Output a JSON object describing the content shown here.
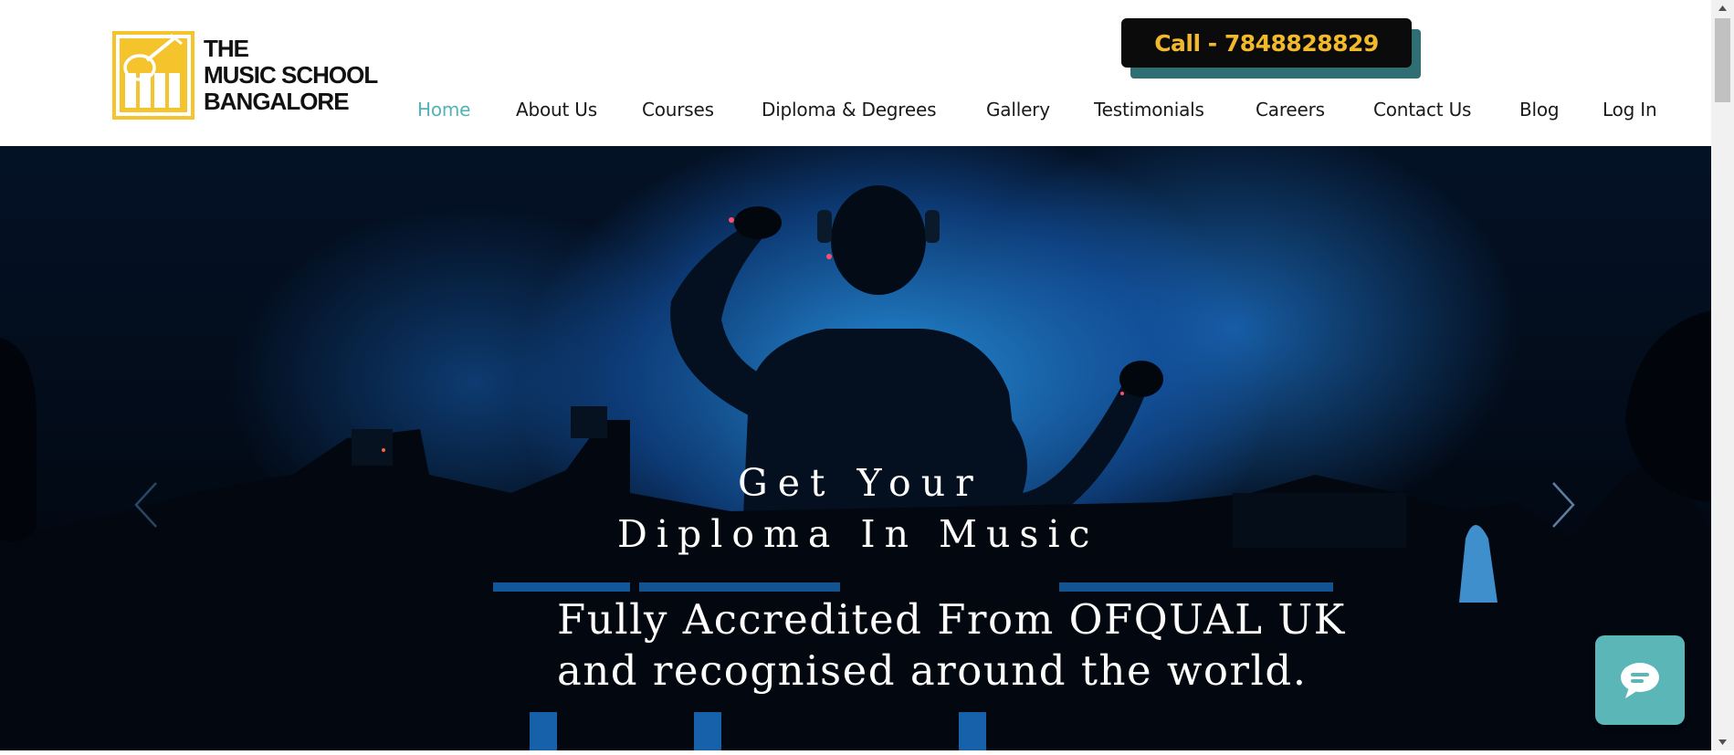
{
  "logo": {
    "line1": "THE",
    "line2": "MUSIC SCHOOL",
    "line3": "BANGALORE",
    "icon": "piano-guitar-logo-icon",
    "color": "#f5c32c"
  },
  "call_button": {
    "label": "Call - 7848828829",
    "text_color": "#f2b92b",
    "bg_color": "#0b0b0b",
    "shadow_color": "#2f6f73"
  },
  "nav": {
    "active_color": "#52b3b6",
    "items": [
      {
        "label": "Home",
        "active": true
      },
      {
        "label": "About Us"
      },
      {
        "label": "Courses"
      },
      {
        "label": "Diploma & Degrees"
      },
      {
        "label": "Gallery"
      },
      {
        "label": "Testimonials"
      },
      {
        "label": "Careers"
      },
      {
        "label": "Contact Us"
      },
      {
        "label": "Blog"
      },
      {
        "label": "Log In"
      }
    ]
  },
  "hero": {
    "line1": "Get Your",
    "line2": "Diploma In Music",
    "line3": "Fully Accredited From OFQUAL UK",
    "line4": "and recognised around the world.",
    "prev_icon": "chevron-left-icon",
    "next_icon": "chevron-right-icon"
  },
  "chat": {
    "icon": "chat-bubble-icon",
    "color": "#5ab6b7"
  }
}
